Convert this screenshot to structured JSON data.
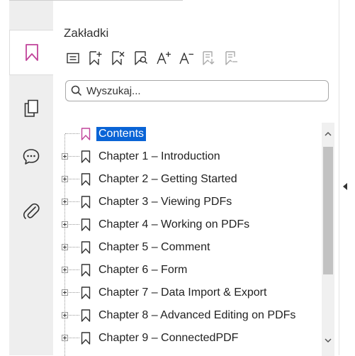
{
  "panel": {
    "title": "Zakładki"
  },
  "search": {
    "placeholder": "Wyszukaj..."
  },
  "tabs": [
    {
      "name": "bookmarks",
      "icon": "bookmark-icon",
      "active": true
    },
    {
      "name": "pages",
      "icon": "pages-icon",
      "active": false
    },
    {
      "name": "comments",
      "icon": "comment-icon",
      "active": false
    },
    {
      "name": "attachments",
      "icon": "paperclip-icon",
      "active": false
    }
  ],
  "toolbar": [
    {
      "name": "options-menu",
      "icon": "list-menu-icon",
      "enabled": true
    },
    {
      "name": "add-bookmark",
      "icon": "add-bookmark-icon",
      "enabled": true
    },
    {
      "name": "delete-bookmark",
      "icon": "delete-bookmark-icon",
      "enabled": true
    },
    {
      "name": "find-current-bookmark",
      "icon": "find-bookmark-icon",
      "enabled": true
    },
    {
      "name": "increase-font",
      "icon": "font-increase-icon",
      "enabled": true
    },
    {
      "name": "decrease-font",
      "icon": "font-decrease-icon",
      "enabled": true
    },
    {
      "name": "expand-all",
      "icon": "expand-bookmarks-icon",
      "enabled": false
    },
    {
      "name": "collapse-all",
      "icon": "collapse-bookmarks-icon",
      "enabled": false
    }
  ],
  "bookmarks": [
    {
      "label": "Contents",
      "selected": true,
      "expandable": false
    },
    {
      "label": "Chapter 1 – Introduction",
      "selected": false,
      "expandable": true
    },
    {
      "label": "Chapter 2 – Getting Started",
      "selected": false,
      "expandable": true
    },
    {
      "label": "Chapter 3 – Viewing PDFs",
      "selected": false,
      "expandable": true
    },
    {
      "label": "Chapter 4 – Working on PDFs",
      "selected": false,
      "expandable": true
    },
    {
      "label": "Chapter 5 – Comment",
      "selected": false,
      "expandable": true
    },
    {
      "label": "Chapter 6 – Form",
      "selected": false,
      "expandable": true
    },
    {
      "label": "Chapter 7 – Data Import & Export",
      "selected": false,
      "expandable": true
    },
    {
      "label": "Chapter 8 – Advanced Editing on PDFs",
      "selected": false,
      "expandable": true
    },
    {
      "label": "Chapter 9 – ConnectedPDF",
      "selected": false,
      "expandable": true
    }
  ],
  "colors": {
    "accent": "#c1439a",
    "selection": "#0a64d6",
    "icon": "#333333",
    "disabled_icon": "#a9a9a9"
  }
}
